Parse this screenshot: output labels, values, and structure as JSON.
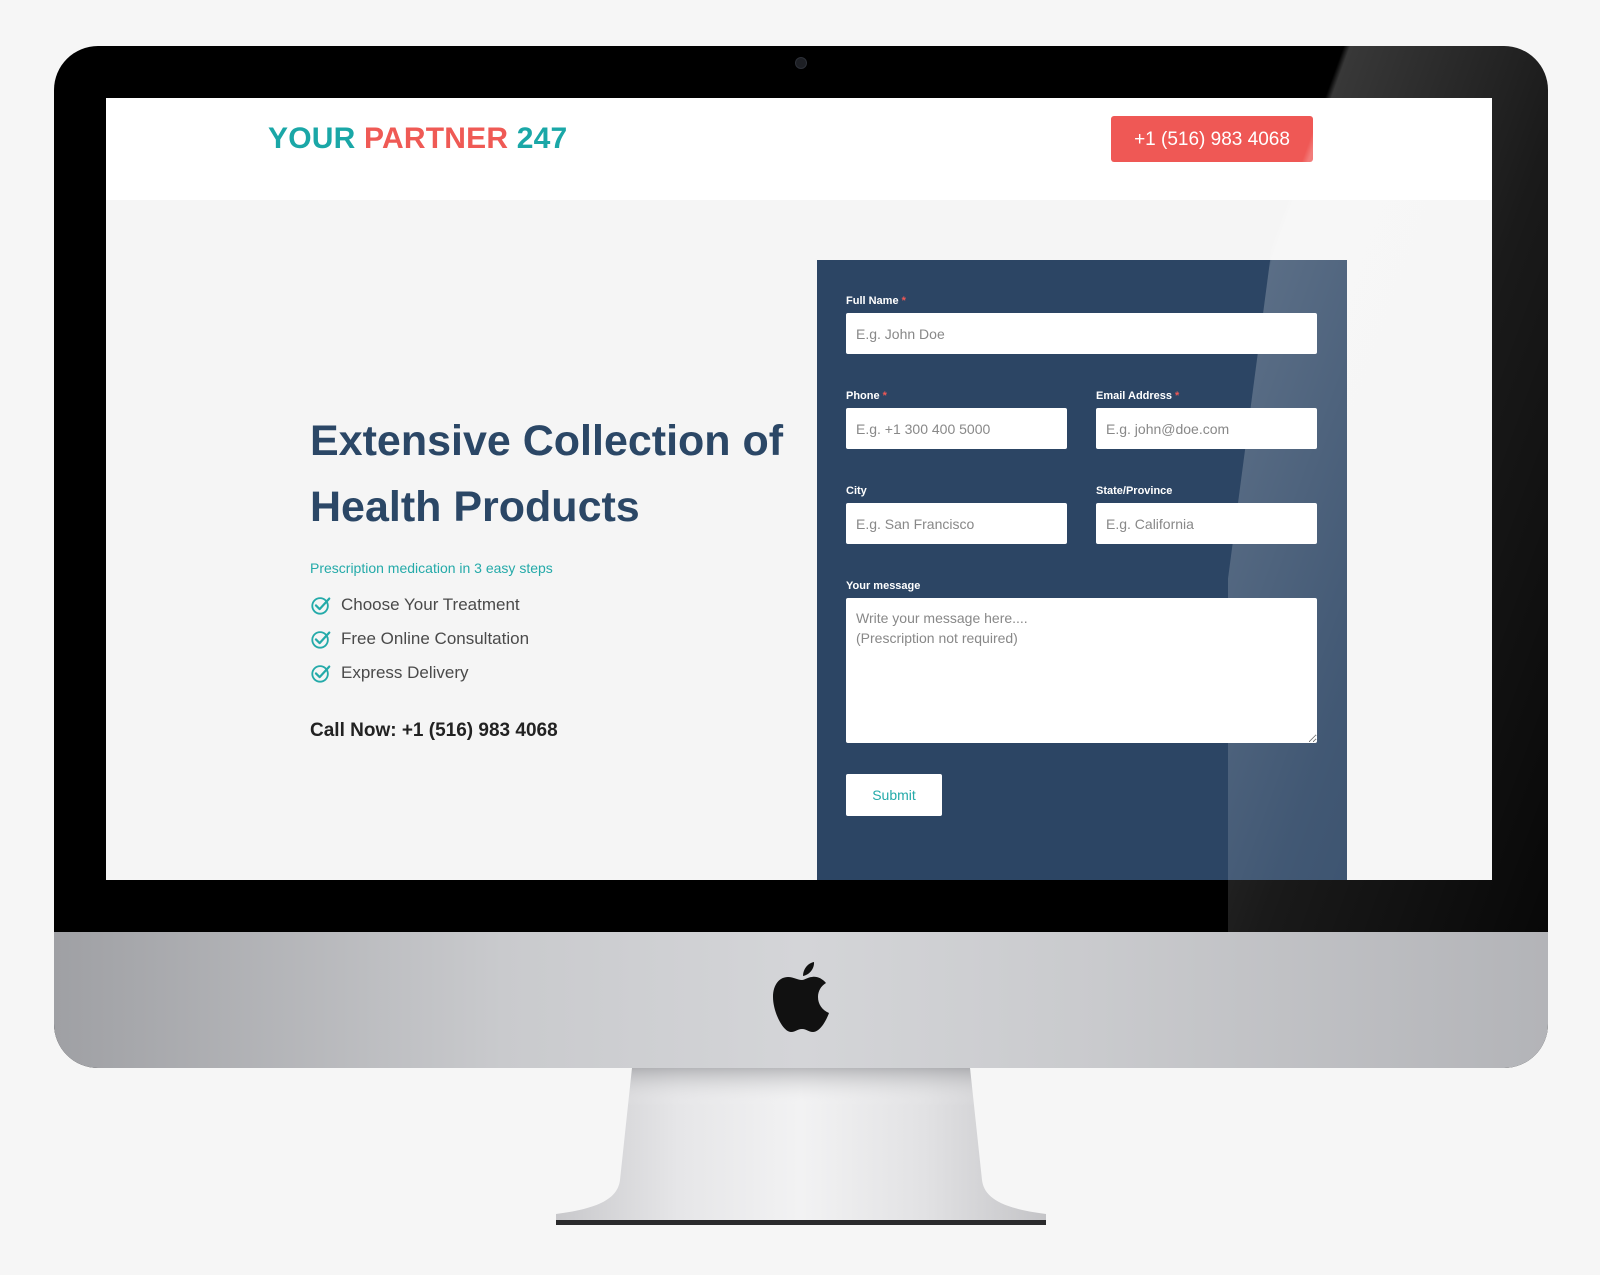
{
  "header": {
    "logo": {
      "part1": "YOUR ",
      "part2": "PARTNER",
      "part3": " 247"
    },
    "phone_button": "+1 (516) 983 4068"
  },
  "hero": {
    "title_line1": "Extensive Collection of",
    "title_line2": "Health Products",
    "subtitle": "Prescription medication in 3 easy steps",
    "steps": [
      "Choose Your Treatment",
      "Free Online Consultation",
      "Express Delivery"
    ],
    "step_icon": "check-circle-icon",
    "call_now": "Call Now: +1 (516) 983 4068"
  },
  "form": {
    "full_name": {
      "label": "Full Name",
      "placeholder": "E.g. John Doe",
      "required": "*"
    },
    "phone": {
      "label": "Phone",
      "placeholder": "E.g. +1 300 400 5000",
      "required": "*"
    },
    "email": {
      "label": "Email Address",
      "placeholder": "E.g. john@doe.com",
      "required": "*"
    },
    "city": {
      "label": "City",
      "placeholder": "E.g. San Francisco"
    },
    "state": {
      "label": "State/Province",
      "placeholder": "E.g. California"
    },
    "message": {
      "label": "Your message",
      "placeholder": "Write your message here....\n(Prescription not required)"
    },
    "submit": "Submit"
  },
  "colors": {
    "brand_teal": "#1aa7a7",
    "brand_coral": "#ef5855",
    "form_navy": "#2c4564",
    "heading_navy": "#2b4766"
  }
}
